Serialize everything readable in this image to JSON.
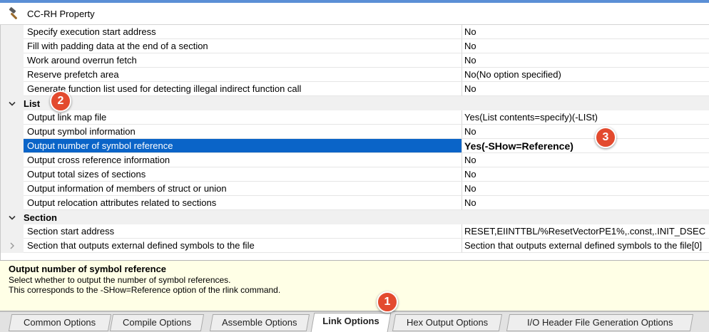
{
  "window": {
    "title": "CC-RH Property"
  },
  "rows": [
    {
      "type": "prop",
      "name": "Specify execution start address",
      "value": "No"
    },
    {
      "type": "prop",
      "name": "Fill with padding data at the end of a section",
      "value": "No"
    },
    {
      "type": "prop",
      "name": "Work around overrun fetch",
      "value": "No"
    },
    {
      "type": "prop",
      "name": "Reserve prefetch area",
      "value": "No(No option specified)"
    },
    {
      "type": "prop",
      "name": "Generate function list used for detecting illegal indirect function call",
      "value": "No"
    },
    {
      "type": "category",
      "name": "List"
    },
    {
      "type": "prop",
      "name": "Output link map file",
      "value": "Yes(List contents=specify)(-LISt)"
    },
    {
      "type": "prop",
      "name": "Output symbol information",
      "value": "No"
    },
    {
      "type": "prop",
      "name": "Output number of symbol reference",
      "value": "Yes(-SHow=Reference)",
      "selected": true
    },
    {
      "type": "prop",
      "name": "Output cross reference information",
      "value": "No"
    },
    {
      "type": "prop",
      "name": "Output total sizes of sections",
      "value": "No"
    },
    {
      "type": "prop",
      "name": "Output information of members of struct or union",
      "value": "No"
    },
    {
      "type": "prop",
      "name": "Output relocation attributes related to sections",
      "value": "No"
    },
    {
      "type": "category",
      "name": "Section"
    },
    {
      "type": "prop",
      "name": "Section start address",
      "value": "RESET,EIINTTBL/%ResetVectorPE1%,.const,.INIT_DSEC"
    },
    {
      "type": "prop",
      "name": "Section that outputs external defined symbols to the file",
      "value": "Section that outputs external defined symbols to the file[0]",
      "expander": true
    }
  ],
  "description": {
    "title": "Output number of symbol reference",
    "line1": "Select whether to output the number of symbol references.",
    "line2": "This corresponds to the -SHow=Reference option of the rlink command."
  },
  "tabs": [
    "Common Options",
    "Compile Options",
    "Assemble Options",
    "Link Options",
    "Hex Output Options",
    "I/O Header File Generation Options"
  ],
  "active_tab": "Link Options",
  "badges": [
    "1",
    "2",
    "3"
  ],
  "colors": {
    "selection": "#0a64c8",
    "badge": "#e34a2e",
    "description_bg": "#ffffe6"
  }
}
